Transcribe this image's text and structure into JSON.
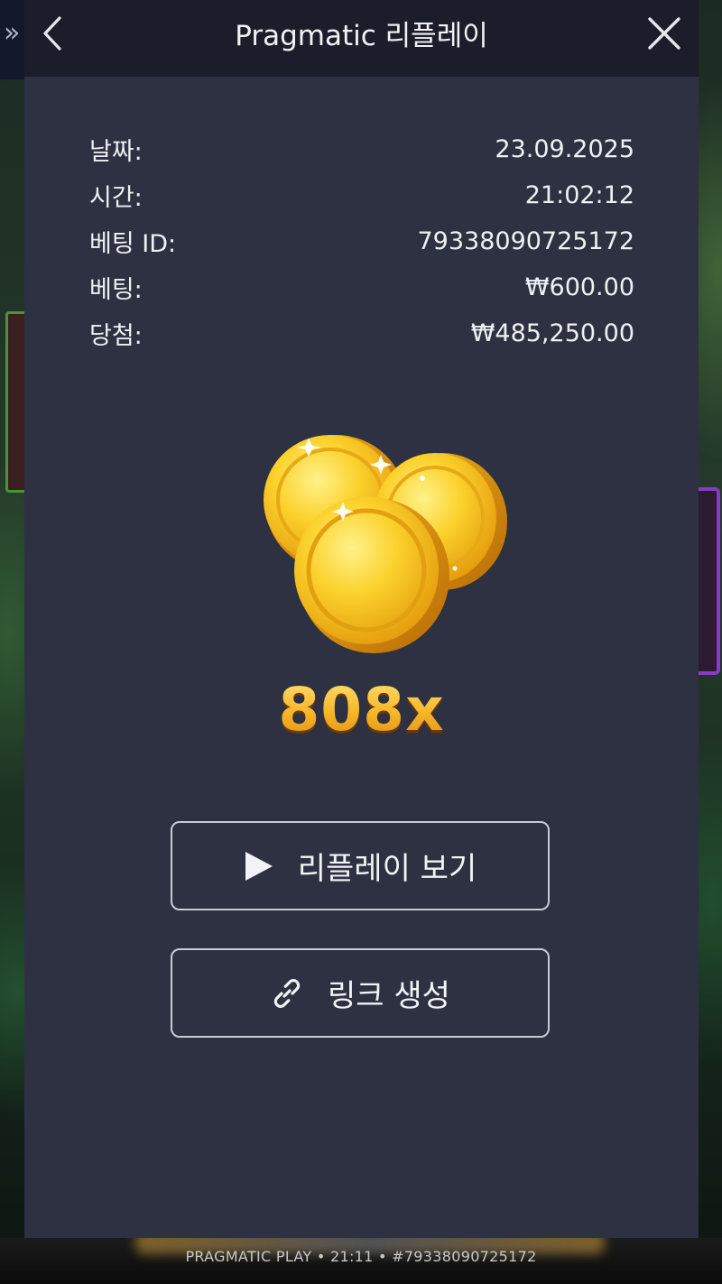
{
  "header": {
    "title": "Pragmatic 리플레이"
  },
  "details": [
    {
      "label": "날짜:",
      "value": "23.09.2025"
    },
    {
      "label": "시간:",
      "value": "21:02:12"
    },
    {
      "label": "베팅 ID:",
      "value": "79338090725172"
    },
    {
      "label": "베팅:",
      "value": "₩600.00"
    },
    {
      "label": "당첨:",
      "value": "₩485,250.00"
    }
  ],
  "win": {
    "multiplier": "808x"
  },
  "buttons": {
    "replay_label": "리플레이 보기",
    "link_label": "링크 생성"
  },
  "background": {
    "side_chevron": "»"
  },
  "footer": {
    "text": "PRAGMATIC PLAY • 21:11 • #79338090725172"
  },
  "colors": {
    "modal_bg": "#2d3142",
    "header_bg": "#1b1d2b",
    "multiplier_gold": "#f6b526"
  }
}
